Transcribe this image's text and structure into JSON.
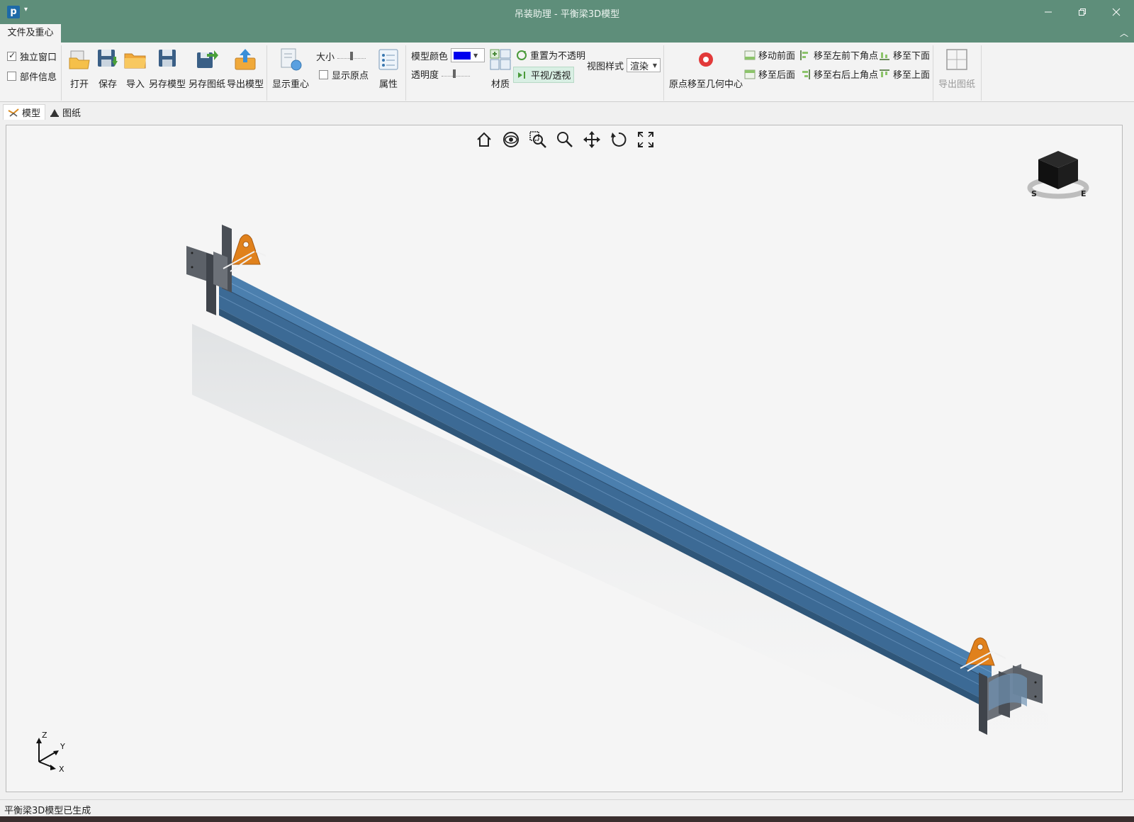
{
  "titlebar": {
    "app_icon_letter": "p",
    "title": "吊装助理 - 平衡梁3D模型"
  },
  "ribbon_tabs": {
    "file_tab": "文件及重心"
  },
  "ribbon": {
    "checkbox_standalone": {
      "label": "独立窗口",
      "checked": true
    },
    "checkbox_parts_info": {
      "label": "部件信息",
      "checked": false
    },
    "buttons": {
      "open": "打开",
      "save": "保存",
      "import": "导入",
      "save_model_as": "另存模型",
      "save_drawing_as": "另存图纸",
      "export_model": "导出模型",
      "show_centroid": "显示重心",
      "properties": "属性",
      "material": "材质",
      "origin_to_center": "原点移至几何中心",
      "export_drawing": "导出图纸"
    },
    "size_label": "大小",
    "show_origin": {
      "label": "显示原点",
      "checked": false
    },
    "model_color_label": "模型颜色",
    "model_color_value": "#0000ee",
    "transparency_label": "透明度",
    "reset_opaque": "重置为不透明",
    "ortho_persp": "平视/透视",
    "view_style_label": "视图样式",
    "view_style_value": "渲染",
    "move_front": "移动前面",
    "move_back": "移至后面",
    "move_left_front_bottom": "移至左前下角点",
    "move_right_back_top": "移至右后上角点",
    "move_bottom": "移至下面",
    "move_top": "移至上面"
  },
  "doc_tabs": {
    "model": "模型",
    "drawing": "图纸"
  },
  "viewport": {
    "tools": [
      "home-icon",
      "eye-icon",
      "zoom-window-icon",
      "zoom-icon",
      "pan-icon",
      "rotate-icon",
      "fullscreen-icon"
    ],
    "axes": {
      "z": "Z",
      "y": "Y",
      "x": "X"
    },
    "viewcube": {
      "s": "S",
      "e": "E"
    },
    "beam_color": "#3c6a95"
  },
  "status": {
    "message": "平衡梁3D模型已生成"
  }
}
